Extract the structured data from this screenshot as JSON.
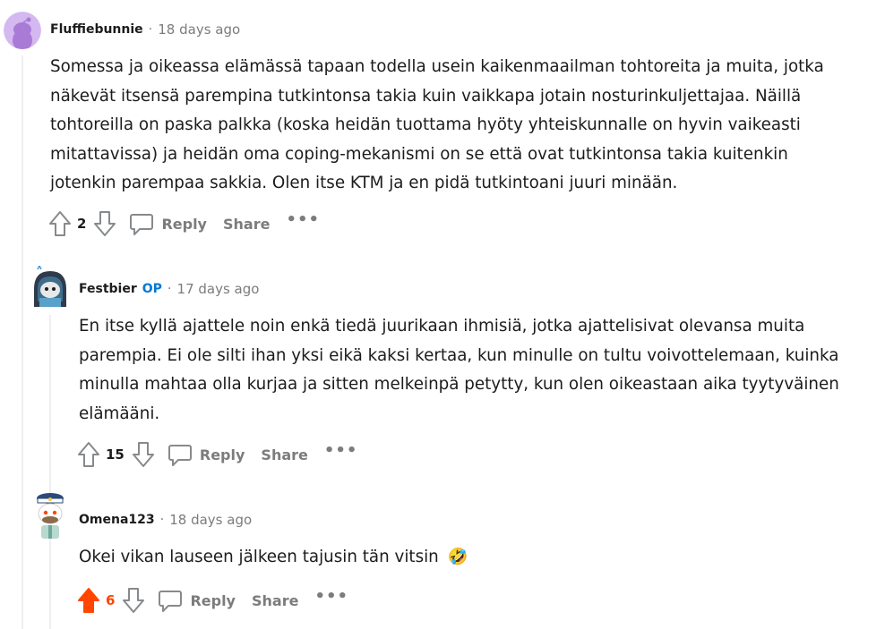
{
  "comments": [
    {
      "author": "Fluffiebunnie",
      "is_op": false,
      "time": "18 days ago",
      "avatar_icon": "snoo-avatar-purple",
      "body": "Somessa ja oikeassa elämässä tapaan todella usein kaikenmaailman tohtoreita ja muita, jotka näkevät itsensä parempina tutkintonsa takia kuin vaikkapa jotain nosturinkuljettajaa. Näillä tohtoreilla on paska palkka (koska heidän tuottama hyöty yhteiskunnalle on hyvin vaikeasti mitattavissa) ja heidän oma coping-mekanismi on se että ovat tutkintonsa takia kuitenkin jotenkin parempaa sakkia. Olen itse KTM ja en pidä tutkintoani juuri minään.",
      "score": "2",
      "upvoted": false,
      "reply_label": "Reply",
      "share_label": "Share",
      "more_label": "•••"
    },
    {
      "author": "Festbier",
      "is_op": true,
      "op_label": "OP",
      "time": "17 days ago",
      "avatar_icon": "snoo-avatar-hooded",
      "body": "En itse kyllä ajattele noin enkä tiedä juurikaan ihmisiä, jotka ajattelisivat olevansa muita parempia. Ei ole silti ihan yksi eikä kaksi kertaa, kun minulle on tultu voivottelemaan, kuinka minulla mahtaa olla kurjaa ja sitten melkeinpä petytty, kun olen oikeastaan aika tyytyväinen elämääni.",
      "score": "15",
      "upvoted": false,
      "reply_label": "Reply",
      "share_label": "Share",
      "more_label": "•••"
    },
    {
      "author": "Omena123",
      "is_op": false,
      "time": "18 days ago",
      "avatar_icon": "snoo-avatar-captain",
      "body": "Okei vikan lauseen jälkeen tajusin tän vitsin",
      "emoji": "🤣",
      "score": "6",
      "upvoted": true,
      "reply_label": "Reply",
      "share_label": "Share",
      "more_label": "•••"
    }
  ],
  "separator": "·",
  "colors": {
    "upvote_active": "#ff4500",
    "meta_gray": "#7c7c7c",
    "op_blue": "#0079d3",
    "thread_line": "#edeff1"
  }
}
